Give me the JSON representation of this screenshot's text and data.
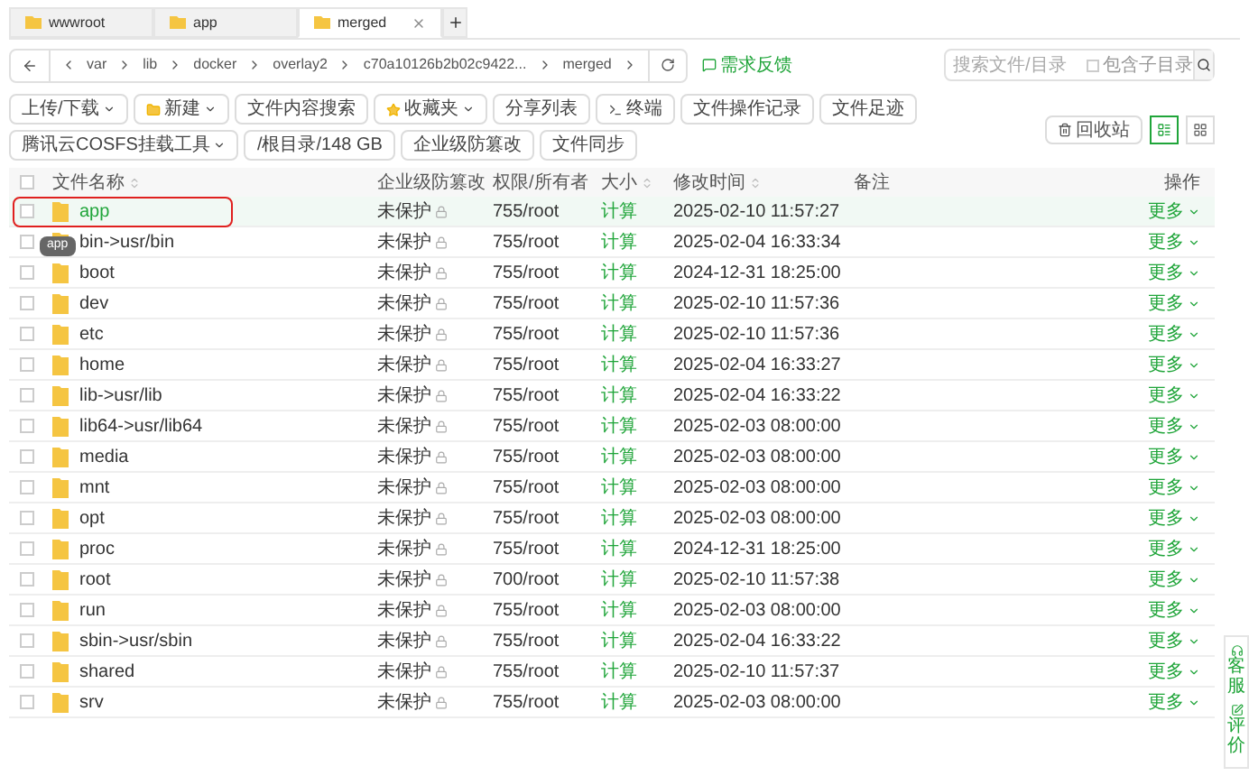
{
  "tabs": [
    {
      "label": "wwwroot",
      "selected": false
    },
    {
      "label": "app",
      "selected": false
    },
    {
      "label": "merged",
      "selected": true
    }
  ],
  "breadcrumb": [
    "var",
    "lib",
    "docker",
    "overlay2",
    "c70a10126b2b02c9422...",
    "merged"
  ],
  "feedback": "需求反馈",
  "search": {
    "placeholder": "搜索文件/目录",
    "subdirs": {
      "label": "包含子目录",
      "checked": false
    }
  },
  "toolbar": [
    {
      "label": "上传/下载",
      "dropdown": true
    },
    {
      "label": "新建",
      "dropdown": true
    },
    {
      "label": "文件内容搜索",
      "dropdown": false
    },
    {
      "label": "收藏夹",
      "dropdown": true
    },
    {
      "label": "分享列表",
      "dropdown": false
    },
    {
      "label": "终端",
      "dropdown": false
    },
    {
      "label": "文件操作记录",
      "dropdown": false
    },
    {
      "label": "文件足迹",
      "dropdown": false
    },
    {
      "label": "腾讯云COSFS挂载工具",
      "dropdown": true
    },
    {
      "label": "/根目录/148 GB",
      "dropdown": false
    },
    {
      "label": "企业级防篡改",
      "dropdown": false
    },
    {
      "label": "文件同步",
      "dropdown": false
    }
  ],
  "select_all": {
    "checked": false
  },
  "recycle": "回收站",
  "view_modes": [
    {
      "selected": true
    },
    {
      "selected": false
    }
  ],
  "columns": [
    {
      "label": "文件名称",
      "sortable": true
    },
    {
      "label": "企业级防篡改",
      "sortable": false
    },
    {
      "label": "权限/所有者",
      "sortable": false
    },
    {
      "label": "大小",
      "sortable": true
    },
    {
      "label": "修改时间",
      "sortable": true
    },
    {
      "label": "备注",
      "sortable": false
    },
    {
      "label": "操作",
      "sortable": false
    }
  ],
  "rows": [
    {
      "name": "app",
      "protection": "未保护",
      "perm": "755/root",
      "size": "计算",
      "modified": "2025-02-10 11:57:27",
      "action": "更多",
      "highlighted": true
    },
    {
      "name": "bin->usr/bin",
      "protection": "未保护",
      "perm": "755/root",
      "size": "计算",
      "modified": "2025-02-04 16:33:34",
      "action": "更多",
      "highlighted": false
    },
    {
      "name": "boot",
      "protection": "未保护",
      "perm": "755/root",
      "size": "计算",
      "modified": "2024-12-31 18:25:00",
      "action": "更多",
      "highlighted": false
    },
    {
      "name": "dev",
      "protection": "未保护",
      "perm": "755/root",
      "size": "计算",
      "modified": "2025-02-10 11:57:36",
      "action": "更多",
      "highlighted": false
    },
    {
      "name": "etc",
      "protection": "未保护",
      "perm": "755/root",
      "size": "计算",
      "modified": "2025-02-10 11:57:36",
      "action": "更多",
      "highlighted": false
    },
    {
      "name": "home",
      "protection": "未保护",
      "perm": "755/root",
      "size": "计算",
      "modified": "2025-02-04 16:33:27",
      "action": "更多",
      "highlighted": false
    },
    {
      "name": "lib->usr/lib",
      "protection": "未保护",
      "perm": "755/root",
      "size": "计算",
      "modified": "2025-02-04 16:33:22",
      "action": "更多",
      "highlighted": false
    },
    {
      "name": "lib64->usr/lib64",
      "protection": "未保护",
      "perm": "755/root",
      "size": "计算",
      "modified": "2025-02-03 08:00:00",
      "action": "更多",
      "highlighted": false
    },
    {
      "name": "media",
      "protection": "未保护",
      "perm": "755/root",
      "size": "计算",
      "modified": "2025-02-03 08:00:00",
      "action": "更多",
      "highlighted": false
    },
    {
      "name": "mnt",
      "protection": "未保护",
      "perm": "755/root",
      "size": "计算",
      "modified": "2025-02-03 08:00:00",
      "action": "更多",
      "highlighted": false
    },
    {
      "name": "opt",
      "protection": "未保护",
      "perm": "755/root",
      "size": "计算",
      "modified": "2025-02-03 08:00:00",
      "action": "更多",
      "highlighted": false
    },
    {
      "name": "proc",
      "protection": "未保护",
      "perm": "755/root",
      "size": "计算",
      "modified": "2024-12-31 18:25:00",
      "action": "更多",
      "highlighted": false
    },
    {
      "name": "root",
      "protection": "未保护",
      "perm": "700/root",
      "size": "计算",
      "modified": "2025-02-10 11:57:38",
      "action": "更多",
      "highlighted": false
    },
    {
      "name": "run",
      "protection": "未保护",
      "perm": "755/root",
      "size": "计算",
      "modified": "2025-02-03 08:00:00",
      "action": "更多",
      "highlighted": false
    },
    {
      "name": "sbin->usr/sbin",
      "protection": "未保护",
      "perm": "755/root",
      "size": "计算",
      "modified": "2025-02-04 16:33:22",
      "action": "更多",
      "highlighted": false
    },
    {
      "name": "shared",
      "protection": "未保护",
      "perm": "755/root",
      "size": "计算",
      "modified": "2025-02-10 11:57:37",
      "action": "更多",
      "highlighted": false
    },
    {
      "name": "srv",
      "protection": "未保护",
      "perm": "755/root",
      "size": "计算",
      "modified": "2025-02-03 08:00:00",
      "action": "更多",
      "highlighted": false
    }
  ],
  "tooltip": "app",
  "side": [
    "客服",
    "评价"
  ]
}
